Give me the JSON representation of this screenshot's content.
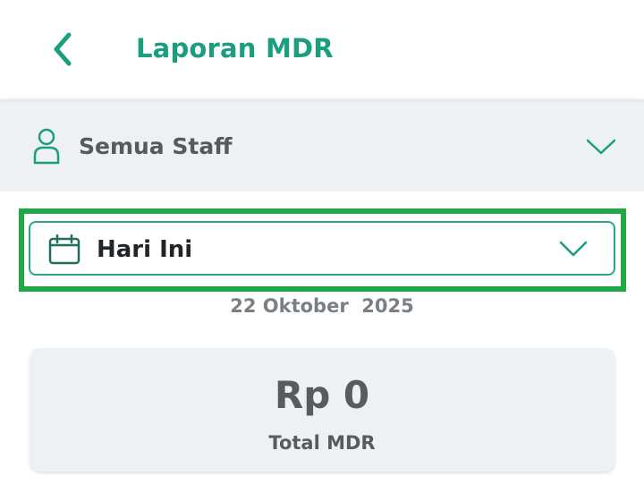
{
  "header": {
    "back_icon": "chevron-left-icon",
    "title": "Laporan MDR"
  },
  "staff_filter": {
    "icon": "user-icon",
    "label": "Semua Staff",
    "dropdown_icon": "chevron-down-icon"
  },
  "date_filter": {
    "icon": "calendar-icon",
    "label": "Hari Ini",
    "dropdown_icon": "chevron-down-icon",
    "highlight_color": "#1fa846"
  },
  "date_text": "22 Oktober  2025",
  "summary": {
    "amount": "Rp 0",
    "label": "Total MDR"
  },
  "colors": {
    "accent": "#1a9e7e",
    "panel": "#eef1f4"
  }
}
